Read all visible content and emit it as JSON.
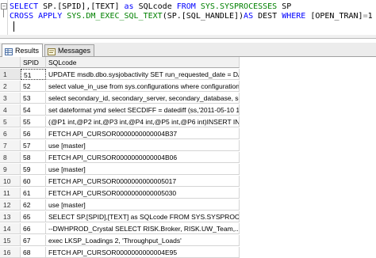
{
  "editor": {
    "line1": {
      "kw1": "SELECT",
      "t1": " SP.[SPID],[TEXT] ",
      "kw2": "as",
      "t2": " SQLcode ",
      "kw3": "FROM",
      "t3": " ",
      "sys1": "SYS.SYSPROCESSES",
      "t4": " SP"
    },
    "line2": {
      "kw1": "CROSS APPLY",
      "t1": " ",
      "sys1": "SYS.DM_EXEC_SQL_TEXT",
      "t2": "(SP.[SQL_HANDLE])",
      "kw2": "AS",
      "t3": " DEST ",
      "kw3": "WHERE",
      "t4": " [OPEN_TRAN]",
      "t5": "=",
      "t6": "1"
    }
  },
  "tabs": {
    "results": "Results",
    "messages": "Messages"
  },
  "grid": {
    "columns": [
      "SPID",
      "SQLcode"
    ],
    "rows": [
      {
        "n": "1",
        "spid": "51",
        "code": "UPDATE msdb.dbo.sysjobactivity SET run_requested_date = DA..."
      },
      {
        "n": "2",
        "spid": "52",
        "code": "select value_in_use from sys.configurations where configuration_i..."
      },
      {
        "n": "3",
        "spid": "53",
        "code": "select secondary_id, secondary_server, secondary_database, se..."
      },
      {
        "n": "4",
        "spid": "54",
        "code": "set dateformat ymd select SECDIFF    = datediff (ss,'2011-05-10 1..."
      },
      {
        "n": "5",
        "spid": "55",
        "code": "(@P1 int,@P2 int,@P3 int,@P4 int,@P5 int,@P6 int)INSERT IN..."
      },
      {
        "n": "6",
        "spid": "56",
        "code": "FETCH API_CURSOR0000000000004B37"
      },
      {
        "n": "7",
        "spid": "57",
        "code": "use [master]"
      },
      {
        "n": "8",
        "spid": "58",
        "code": "FETCH API_CURSOR0000000000004B06"
      },
      {
        "n": "9",
        "spid": "59",
        "code": "use [master]"
      },
      {
        "n": "10",
        "spid": "60",
        "code": "FETCH API_CURSOR0000000000005017"
      },
      {
        "n": "11",
        "spid": "61",
        "code": "FETCH API_CURSOR0000000000005030"
      },
      {
        "n": "12",
        "spid": "62",
        "code": "use [master]"
      },
      {
        "n": "13",
        "spid": "65",
        "code": "SELECT SP.[SPID],[TEXT] as SQLcode FROM SYS.SYSPROC..."
      },
      {
        "n": "14",
        "spid": "66",
        "code": "--DWHPROD_Crystal  SELECT RISK.Broker,  RISK.UW_Team,..."
      },
      {
        "n": "15",
        "spid": "67",
        "code": "exec LKSP_Loadings 2, 'Throughput_Loads'"
      },
      {
        "n": "16",
        "spid": "68",
        "code": "FETCH API_CURSOR0000000000004E95"
      }
    ]
  }
}
